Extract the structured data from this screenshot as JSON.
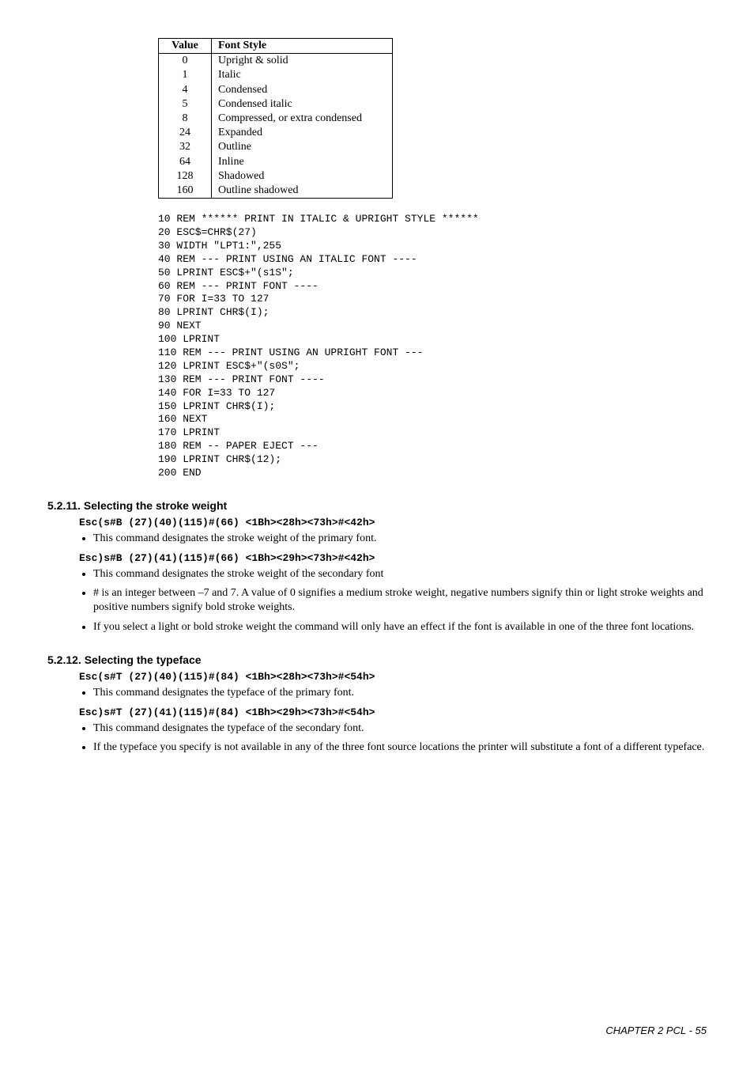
{
  "table": {
    "headers": {
      "value": "Value",
      "font_style": "Font Style"
    },
    "rows": [
      {
        "value": "0",
        "style": "Upright & solid"
      },
      {
        "value": "1",
        "style": "Italic"
      },
      {
        "value": "4",
        "style": "Condensed"
      },
      {
        "value": "5",
        "style": "Condensed italic"
      },
      {
        "value": "8",
        "style": "Compressed, or extra condensed"
      },
      {
        "value": "24",
        "style": "Expanded"
      },
      {
        "value": "32",
        "style": "Outline"
      },
      {
        "value": "64",
        "style": "Inline"
      },
      {
        "value": "128",
        "style": "Shadowed"
      },
      {
        "value": "160",
        "style": "Outline shadowed"
      }
    ]
  },
  "code": "10 REM ****** PRINT IN ITALIC & UPRIGHT STYLE ******\n20 ESC$=CHR$(27)\n30 WIDTH \"LPT1:\",255\n40 REM --- PRINT USING AN ITALIC FONT ----\n50 LPRINT ESC$+\"(s1S\";\n60 REM --- PRINT FONT ----\n70 FOR I=33 TO 127\n80 LPRINT CHR$(I);\n90 NEXT\n100 LPRINT\n110 REM --- PRINT USING AN UPRIGHT FONT ---\n120 LPRINT ESC$+\"(s0S\";\n130 REM --- PRINT FONT ----\n140 FOR I=33 TO 127\n150 LPRINT CHR$(I);\n160 NEXT\n170 LPRINT\n180 REM -- PAPER EJECT ---\n190 LPRINT CHR$(12);\n200 END",
  "sections": {
    "stroke": {
      "heading": "5.2.11.  Selecting the stroke weight",
      "cmd1": "Esc(s#B (27)(40)(115)#(66) <1Bh><28h><73h>#<42h>",
      "b1": "This command designates the stroke weight of the primary font.",
      "cmd2": "Esc)s#B (27)(41)(115)#(66) <1Bh><29h><73h>#<42h>",
      "b2": "This command designates the stroke weight of the secondary font",
      "b3": "# is an integer between –7 and 7. A value of 0 signifies a medium stroke weight, negative numbers signify thin or light stroke weights and positive numbers signify bold stroke weights.",
      "b4": "If you select a light or bold stroke weight the command will only have an effect if the font is available in one of the three font locations."
    },
    "typeface": {
      "heading": "5.2.12.  Selecting the typeface",
      "cmd1": "Esc(s#T (27)(40)(115)#(84) <1Bh><28h><73h>#<54h>",
      "b1": "This command designates the typeface of the primary font.",
      "cmd2": "Esc)s#T (27)(41)(115)#(84) <1Bh><29h><73h>#<54h>",
      "b2": "This command designates the typeface of the secondary font.",
      "b3": "If the typeface you specify is not available in any of the three font source locations the printer will substitute a font of a different typeface."
    }
  },
  "footer": "CHAPTER 2 PCL - 55"
}
